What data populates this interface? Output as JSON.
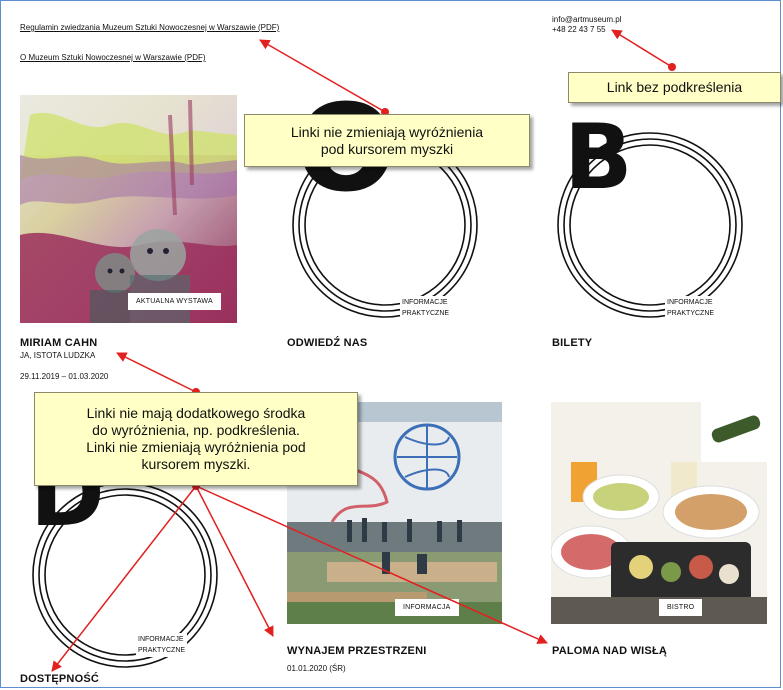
{
  "header_links": {
    "regulations": "Regulamin zwiedzania Muzeum Sztuki Nowoczesnej w Warszawie (PDF)",
    "about": "O Muzeum Sztuki Nowoczesnej w Warszawie (PDF)"
  },
  "contact": {
    "email": "info@artmuseum.pl",
    "phone": "+48 22 43 7 55"
  },
  "tiles": {
    "exhibition": {
      "image_label": "AKTUALNA WYSTAWA",
      "title": "MIRIAM CAHN",
      "subtitle": "JA, ISTOTA LUDZKA",
      "dates": "29.11.2019 – 01.03.2020"
    },
    "visit": {
      "letter": "O",
      "info_line1": "INFORMACJE",
      "info_line2": "PRAKTYCZNE",
      "title": "ODWIEDŹ NAS"
    },
    "tickets": {
      "letter": "B",
      "info_line1": "INFORMACJE",
      "info_line2": "PRAKTYCZNE",
      "title": "BILETY"
    },
    "accessibility": {
      "letter": "D",
      "info_line1": "INFORMACJE",
      "info_line2": "PRAKTYCZNE",
      "title": "DOSTĘPNOŚĆ"
    },
    "rental": {
      "image_label": "INFORMACJA",
      "title": "WYNAJEM PRZESTRZENI",
      "date": "01.01.2020 (ŚR)"
    },
    "bistro": {
      "image_label": "BISTRO",
      "title": "PALOMA NAD WISŁĄ"
    }
  },
  "callouts": {
    "hover": [
      "Linki nie zmieniają wyróżnienia",
      "pod kursorem myszki"
    ],
    "no_underline": "Link bez podkreślenia",
    "no_extra": [
      "Linki nie mają dodatkowego środka",
      "do wyróżnienia, np. podkreślenia.",
      "Linki nie zmieniają wyróżnienia pod",
      "kursorem myszki."
    ]
  },
  "colors": {
    "arrow": "#e32020",
    "callout_bg": "#ffffc6",
    "frame": "#5b8fd0"
  }
}
